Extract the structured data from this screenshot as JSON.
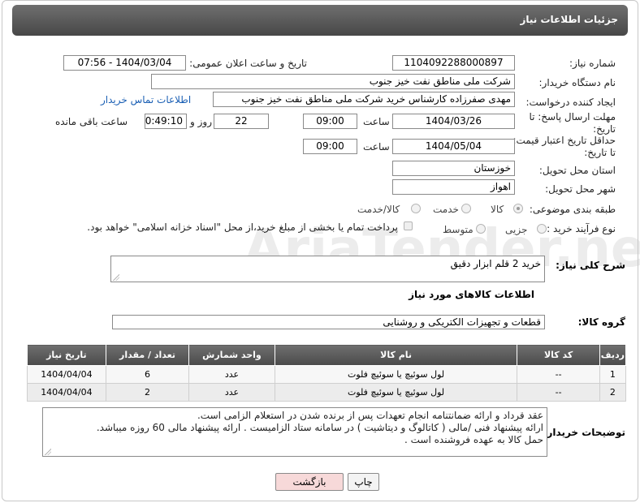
{
  "header": {
    "title": "جزئیات اطلاعات نیاز"
  },
  "fields": {
    "need_number_label": "شماره نیاز:",
    "need_number": "1104092288000897",
    "announce_label": "تاریخ و ساعت اعلان عمومی:",
    "announce_value": "1404/03/04 - 07:56",
    "buyer_org_label": "نام دستگاه خریدار:",
    "buyer_org": "شرکت ملی مناطق نفت خیز جنوب",
    "requester_label": "ایجاد کننده درخواست:",
    "requester": "مهدی صفرزاده کارشناس خرید شرکت ملی مناطق نفت خیز جنوب",
    "contact_link": "اطلاعات تماس خریدار",
    "deadline_label": "مهلت ارسال پاسخ: تا تاریخ:",
    "deadline_date": "1404/03/26",
    "time_label": "ساعت",
    "deadline_time": "09:00",
    "days_value": "22",
    "days_label": "روز و",
    "remaining_value": "00:49:10",
    "remaining_label": "ساعت باقی مانده",
    "validity_label": "حداقل تاریخ اعتبار قیمت: تا تاریخ:",
    "validity_date": "1404/05/04",
    "validity_time": "09:00",
    "province_label": "استان محل تحویل:",
    "province": "خوزستان",
    "city_label": "شهر محل تحویل:",
    "city": "اهواز",
    "category_label": "طبقه بندی موضوعی:",
    "category_options": [
      "کالا",
      "خدمت",
      "کالا/خدمت"
    ],
    "process_label": "نوع فرآیند خرید :",
    "process_options": [
      "جزیی",
      "متوسط"
    ],
    "payment_note": "پرداخت تمام یا بخشی از مبلغ خرید،از محل \"اسناد خزانه اسلامی\" خواهد بود."
  },
  "description": {
    "label": "شرح کلی نیاز:",
    "value": "خرید 2 قلم ابزار دقیق"
  },
  "goods": {
    "section_title": "اطلاعات کالاهای مورد نیاز",
    "group_label": "گروه کالا:",
    "group_value": "قطعات و تجهیزات الکتریکی و روشنایی"
  },
  "table": {
    "headers": [
      "ردیف",
      "کد کالا",
      "نام کالا",
      "واحد شمارش",
      "تعداد / مقدار",
      "تاریخ نیاز"
    ],
    "rows": [
      [
        "1",
        "--",
        "لول سوئیچ یا سوئیچ فلوت",
        "عدد",
        "6",
        "1404/04/04"
      ],
      [
        "2",
        "--",
        "لول سوئیچ یا سوئیچ فلوت",
        "عدد",
        "2",
        "1404/04/04"
      ]
    ]
  },
  "notes": {
    "label": "توضیحات خریدار:",
    "lines": [
      "عقد قرداد و ارائه ضمانتنامه انجام تعهدات پس از برنده شدن در استعلام الزامی است.",
      "ارائه پیشنهاد فنی /مالی ( کاتالوگ و دیتاشیت ) در سامانه ستاد الزامیست . ارائه پیشنهاد مالی 60 روزه میباشد.",
      "حمل کالا به عهده فروشنده است ."
    ]
  },
  "buttons": {
    "print": "چاپ",
    "back": "بازگشت"
  },
  "colors": {
    "header_bg": "#555555",
    "link": "#1a5fb4",
    "back_btn_bg": "#f7d9d9"
  }
}
